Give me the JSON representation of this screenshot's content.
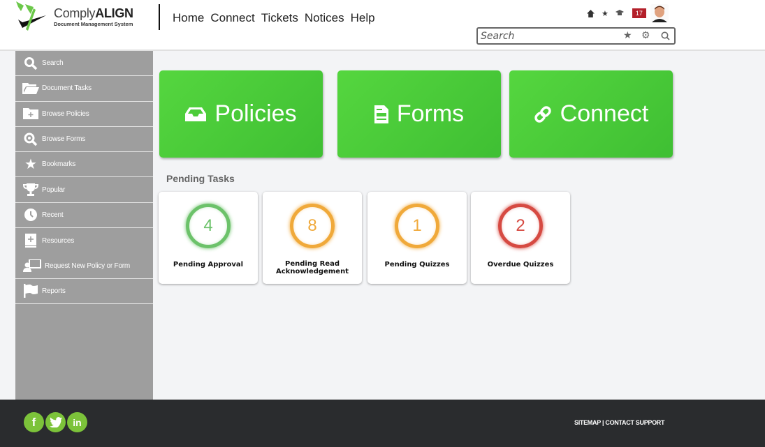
{
  "header": {
    "brand_light": "Comply",
    "brand_bold": "ALIGN",
    "brand_subtitle": "Document Management System",
    "nav": [
      "Home",
      "Connect",
      "Tickets",
      "Notices",
      "Help"
    ],
    "notification_count": "17",
    "search_placeholder": "Search",
    "icons": [
      "home-icon",
      "star-icon",
      "graduation-cap-icon",
      "notification-badge",
      "avatar"
    ]
  },
  "sidebar": {
    "items": [
      {
        "label": "Search",
        "icon": "search-icon"
      },
      {
        "label": "Document Tasks",
        "icon": "folder-open-icon"
      },
      {
        "label": "Browse Policies",
        "icon": "folder-plus-icon"
      },
      {
        "label": "Browse Forms",
        "icon": "search-circle-icon"
      },
      {
        "label": "Bookmarks",
        "icon": "star-icon"
      },
      {
        "label": "Popular",
        "icon": "trophy-icon"
      },
      {
        "label": "Recent",
        "icon": "clock-icon"
      },
      {
        "label": "Resources",
        "icon": "book-plus-icon"
      },
      {
        "label": "Request New Policy or Form",
        "icon": "presenter-icon"
      },
      {
        "label": "Reports",
        "icon": "flag-icon"
      }
    ]
  },
  "tiles": [
    {
      "label": "Policies",
      "icon": "inbox-icon"
    },
    {
      "label": "Forms",
      "icon": "file-icon"
    },
    {
      "label": "Connect",
      "icon": "link-icon"
    }
  ],
  "pending": {
    "title": "Pending Tasks",
    "cards": [
      {
        "count": "4",
        "label": "Pending Approval",
        "color": "#6cc26a"
      },
      {
        "count": "8",
        "label": "Pending Read Acknowledgement",
        "color": "#f0a93a"
      },
      {
        "count": "1",
        "label": "Pending Quizzes",
        "color": "#f0a93a"
      },
      {
        "count": "2",
        "label": "Overdue Quizzes",
        "color": "#d64a42"
      }
    ]
  },
  "footer": {
    "social": [
      "f",
      "t",
      "in"
    ],
    "sitemap": "SITEMAP",
    "separator": " | ",
    "contact": "CONTACT SUPPORT"
  },
  "colors": {
    "accent_green": "#4ccc3a",
    "sidebar_bg": "#9e9e9e",
    "footer_bg": "#2a2c2e",
    "badge_red": "#b3202a"
  }
}
